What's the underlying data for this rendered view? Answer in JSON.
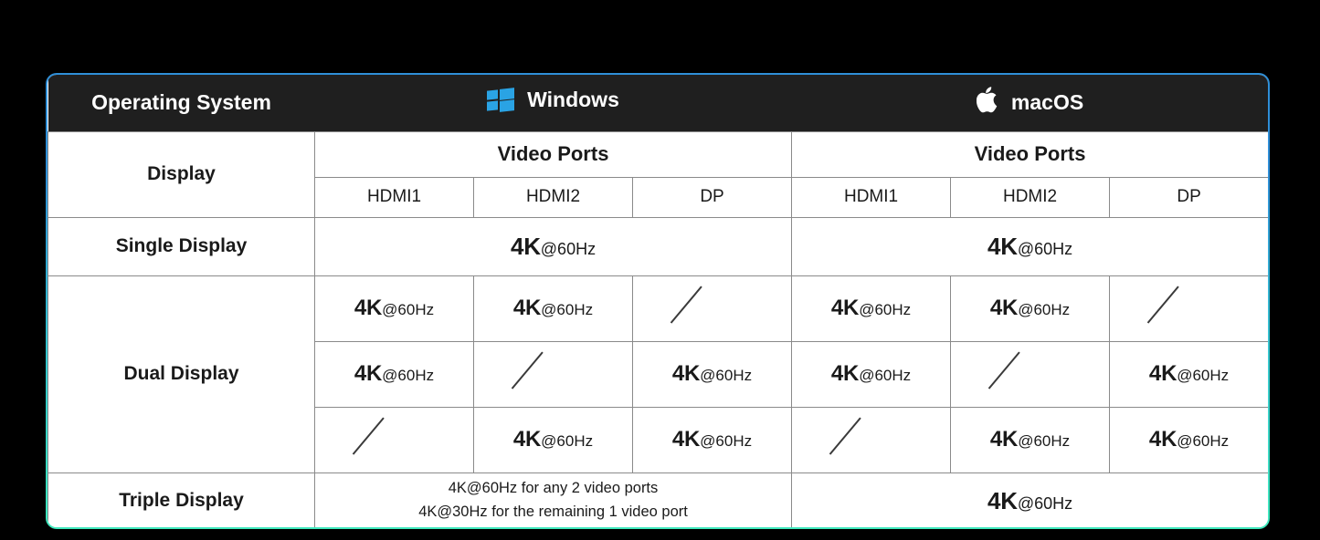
{
  "table": {
    "header": {
      "os_label": "Operating System",
      "windows": {
        "label": "Windows",
        "icon": "windows-logo-icon",
        "icon_color": "#2aa3e4"
      },
      "macos": {
        "label": "macOS",
        "icon": "apple-logo-icon",
        "icon_color": "#ffffff"
      }
    },
    "display_label": "Display",
    "video_ports_label": "Video Ports",
    "port_headers": [
      "HDMI1",
      "HDMI2",
      "DP"
    ],
    "rows": {
      "single": {
        "label": "Single Display",
        "windows_merged": "4K@60Hz",
        "macos_merged": "4K@60Hz",
        "windows_value_big": "4K",
        "windows_value_small": "@60Hz",
        "macos_value_big": "4K",
        "macos_value_small": "@60Hz"
      },
      "dual": {
        "label": "Dual Display",
        "lines": [
          {
            "windows": [
              "4K@60Hz",
              "4K@60Hz",
              "/"
            ],
            "macos": [
              "4K@60Hz",
              "4K@60Hz",
              "/"
            ]
          },
          {
            "windows": [
              "4K@60Hz",
              "/",
              "4K@60Hz"
            ],
            "macos": [
              "4K@60Hz",
              "/",
              "4K@60Hz"
            ]
          },
          {
            "windows": [
              "/",
              "4K@60Hz",
              "4K@60Hz"
            ],
            "macos": [
              "/",
              "4K@60Hz",
              "4K@60Hz"
            ]
          }
        ]
      },
      "triple": {
        "label": "Triple Display",
        "windows_note_line1": "4K@60Hz for any 2 video ports",
        "windows_note_line2": "4K@30Hz for the remaining 1 video port",
        "macos_value_big": "4K",
        "macos_value_small": "@60Hz",
        "macos_merged": "4K@60Hz"
      }
    },
    "value_parts": {
      "big": "4K",
      "small": "@60Hz"
    },
    "colors": {
      "background": "#000000",
      "header_bg": "#1f1f1f",
      "cell_bg": "#ffffff",
      "grid_line": "#8a8a8a",
      "muted_text": "#8d8d8d",
      "border_top": "#2f8fd8",
      "border_bottom": "#3fe9bd"
    }
  }
}
